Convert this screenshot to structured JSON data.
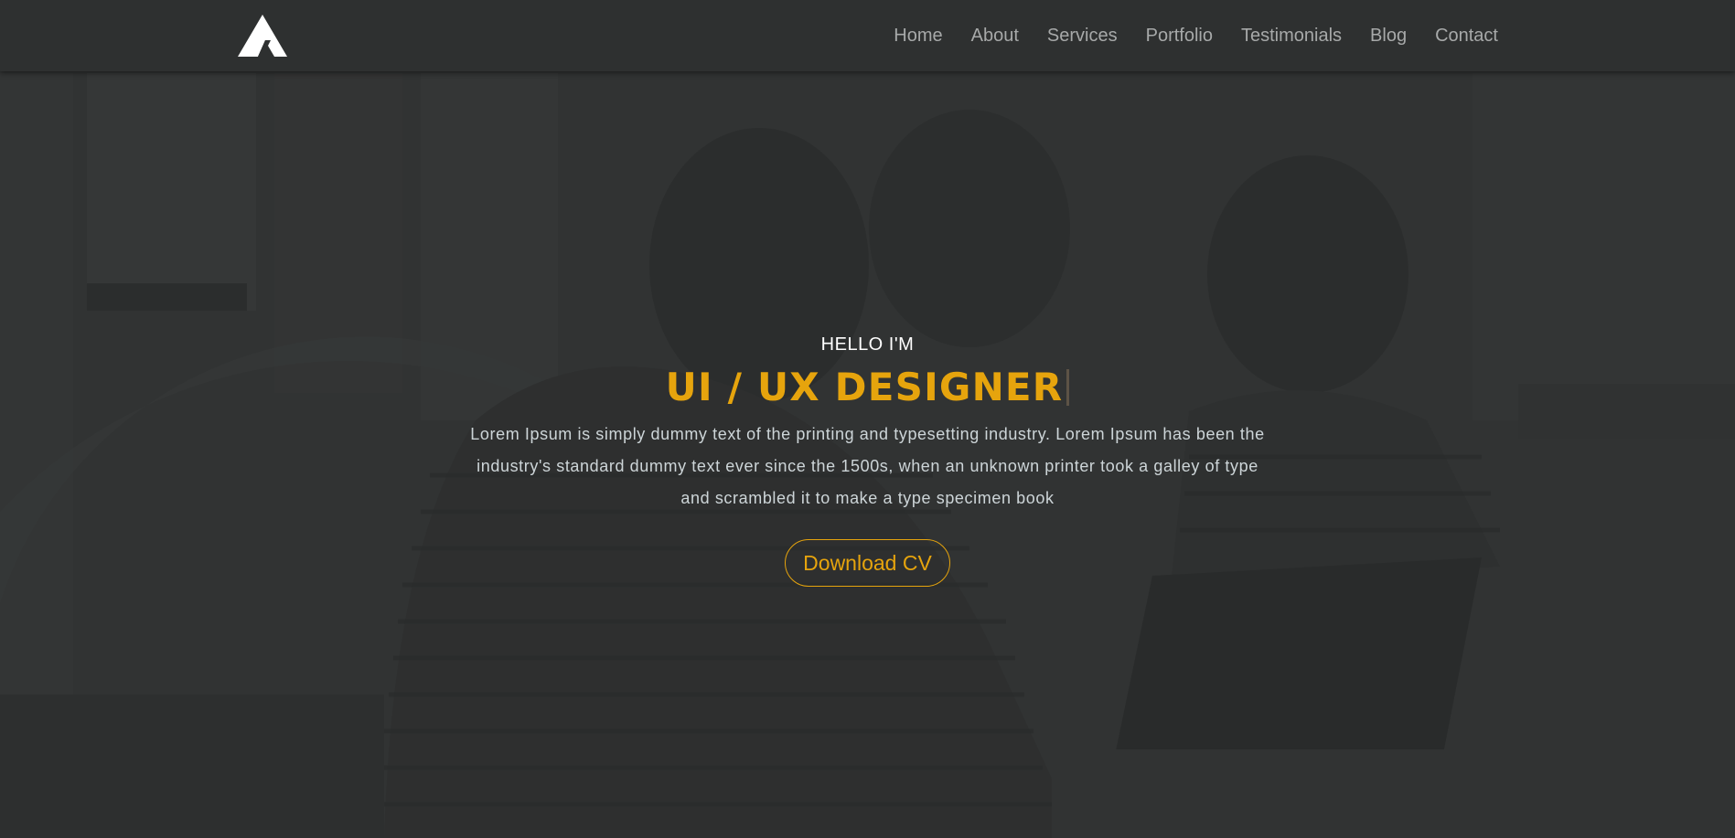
{
  "brand": {
    "logo_icon": "triangle-a-logo-icon"
  },
  "nav": {
    "items": [
      {
        "label": "Home"
      },
      {
        "label": "About"
      },
      {
        "label": "Services"
      },
      {
        "label": "Portfolio"
      },
      {
        "label": "Testimonials"
      },
      {
        "label": "Blog"
      },
      {
        "label": "Contact"
      }
    ]
  },
  "hero": {
    "eyebrow": "HELLO I'M",
    "headline": "UI / UX DESIGNER",
    "description": "Lorem Ipsum is simply dummy text of the printing and typesetting industry. Lorem Ipsum has been the industry's standard dummy text ever since the 1500s, when an unknown printer took a galley of type and scrambled it to make a type specimen book",
    "cta_label": "Download CV"
  },
  "colors": {
    "accent": "#e6a40d",
    "nav_bg": "#2e3030",
    "nav_text": "#a7a9a9",
    "body_text": "#cdd5d8"
  }
}
